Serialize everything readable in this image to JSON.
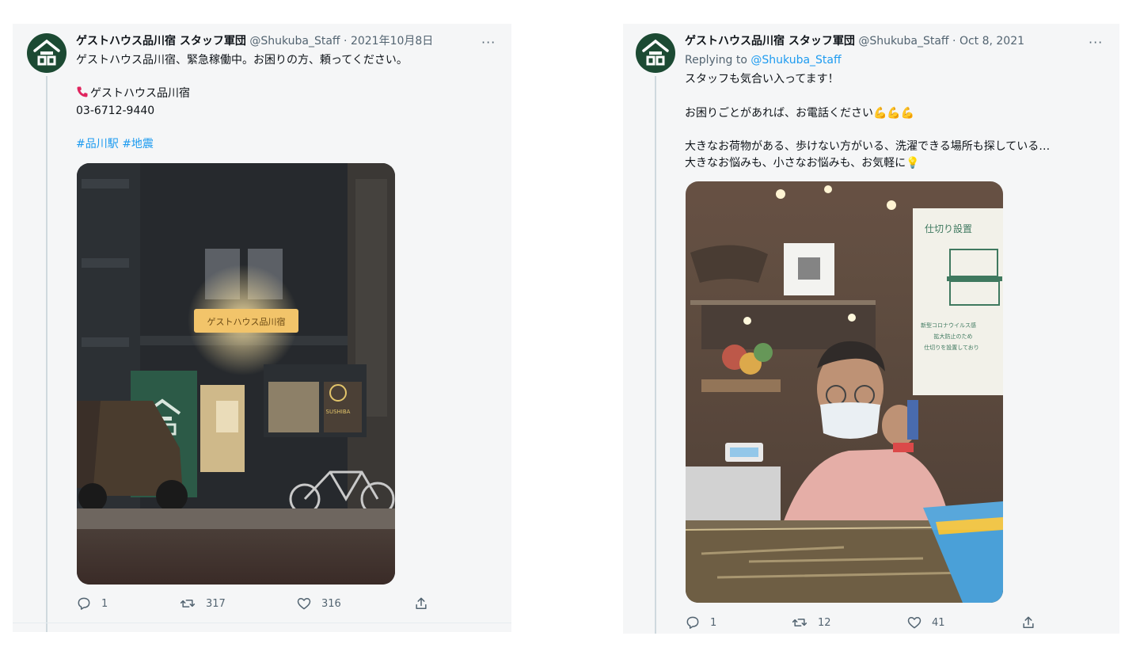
{
  "left_tweet": {
    "display_name": "ゲストハウス品川宿 スタッフ軍団",
    "handle": "@Shukuba_Staff",
    "separator": " · ",
    "date": "2021年10月8日",
    "more_label": "···",
    "line1": "ゲストハウス品川宿、緊急稼働中。お困りの方、頼ってください。",
    "phone_label": "ゲストハウス品川宿",
    "phone_number": "03-6712-9440",
    "hashtag1": "#品川駅",
    "hashtag2": "#地震",
    "photo_sign_text": "ゲストハウス品川宿",
    "photo_sign_text2": "SUSHIBA",
    "reply_count": "1",
    "retweet_count": "317",
    "like_count": "316"
  },
  "right_tweet": {
    "display_name": "ゲストハウス品川宿 スタッフ軍団",
    "handle": "@Shukuba_Staff",
    "separator": " · ",
    "date": "Oct 8, 2021",
    "more_label": "···",
    "replying_prefix": "Replying to ",
    "replying_handle": "@Shukuba_Staff",
    "line1": "スタッフも気合い入ってます！",
    "line2": "お困りごとがあれば、お電話ください💪💪💪",
    "line3": "大きなお荷物がある、歩けない方がいる、洗濯できる場所も探している…",
    "line4": "大きなお悩みも、小さなお悩みも、お気軽に💡",
    "photo_poster_title": "仕切り設置",
    "photo_poster_line1": "新型コロナウイルス感",
    "photo_poster_line2": "拡大防止のため",
    "photo_poster_line3": "仕切りを設置しており",
    "reply_count": "1",
    "retweet_count": "12",
    "like_count": "41"
  },
  "colors": {
    "panel_bg": "#f5f6f7",
    "avatar_green": "#1c4a33",
    "link_blue": "#1d9bf0",
    "muted_gray": "#536471",
    "thread_line": "#cfd9de"
  },
  "icons": [
    "house-logo-icon",
    "phone-icon",
    "reply-icon",
    "retweet-icon",
    "like-icon",
    "share-icon",
    "more-icon"
  ]
}
